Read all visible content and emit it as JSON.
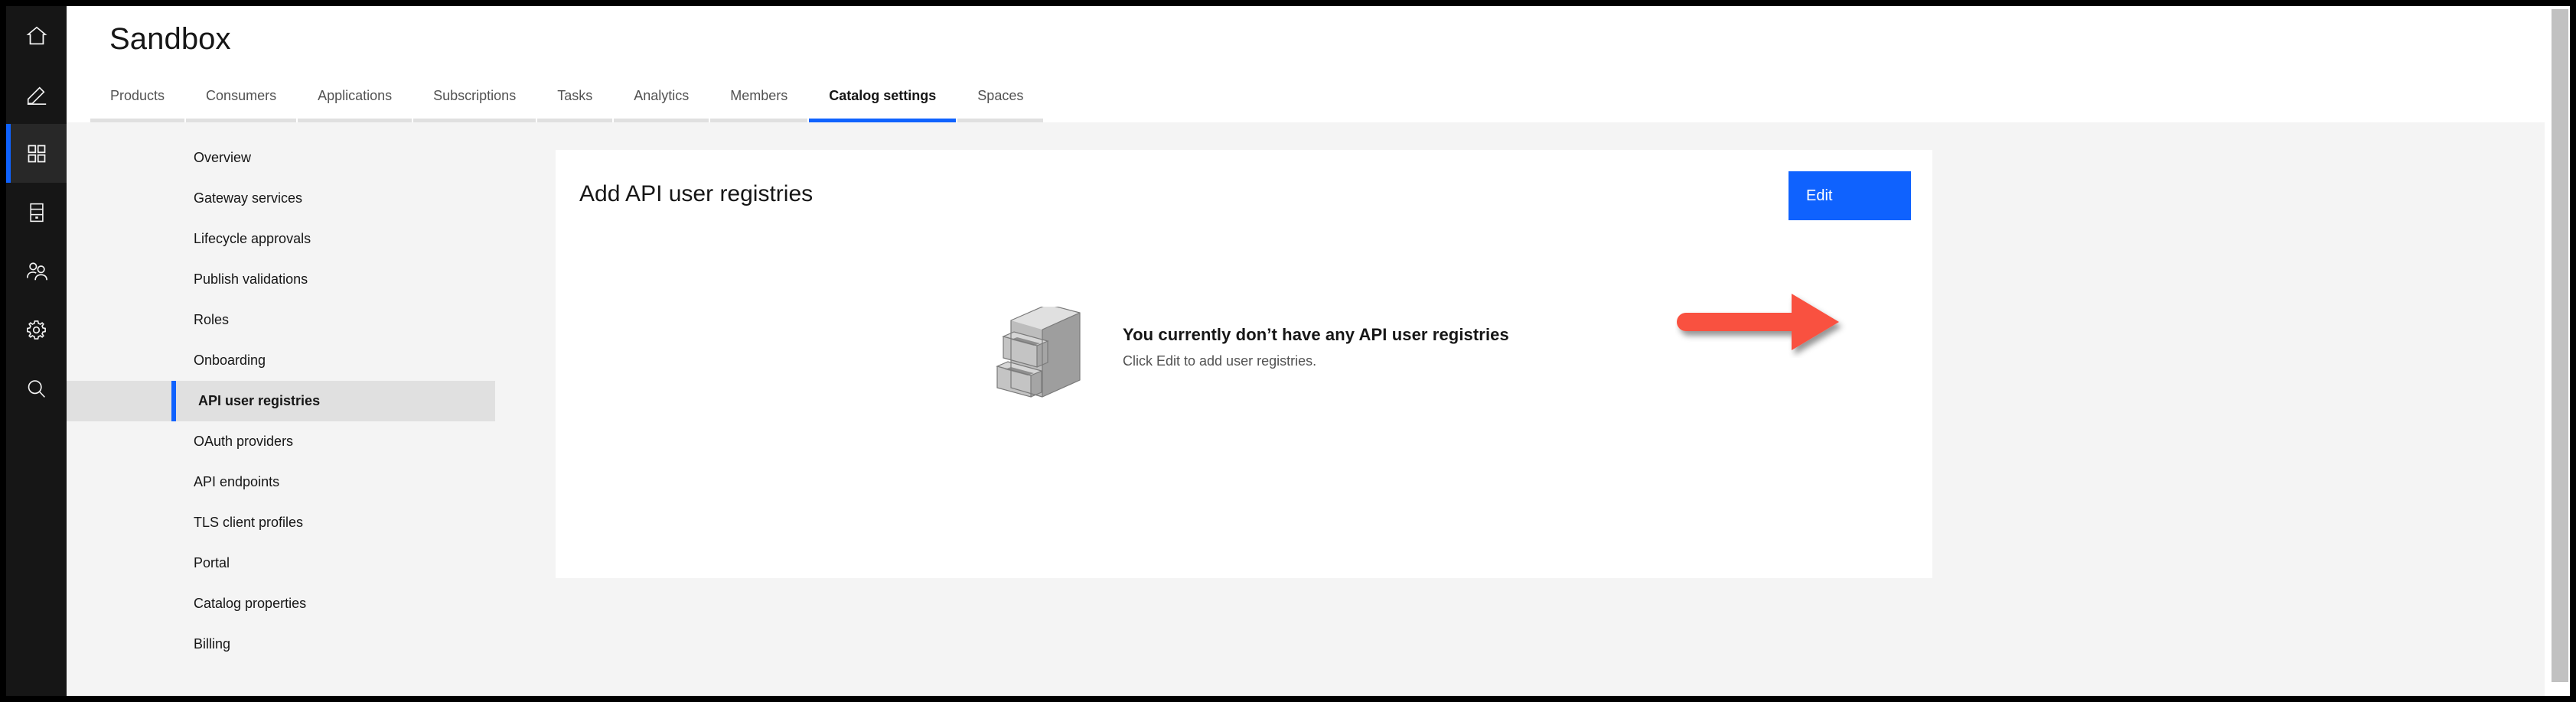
{
  "window": {
    "background": "#f4f4f4",
    "accent": "#0f62fe",
    "rail_background": "#161616",
    "annotation_color": "#f9513f"
  },
  "rail": {
    "items": [
      {
        "icon": "home-icon",
        "name": "home"
      },
      {
        "icon": "pencil-icon",
        "name": "edit"
      },
      {
        "icon": "grid-apps-icon",
        "name": "apps",
        "active": true
      },
      {
        "icon": "server-icon",
        "name": "server"
      },
      {
        "icon": "users-icon",
        "name": "users"
      },
      {
        "icon": "gear-icon",
        "name": "settings"
      },
      {
        "icon": "search-icon",
        "name": "search"
      }
    ]
  },
  "header": {
    "title": "Sandbox"
  },
  "tabs": {
    "items": [
      {
        "label": "Products",
        "active": false
      },
      {
        "label": "Consumers",
        "active": false
      },
      {
        "label": "Applications",
        "active": false
      },
      {
        "label": "Subscriptions",
        "active": false
      },
      {
        "label": "Tasks",
        "active": false
      },
      {
        "label": "Analytics",
        "active": false
      },
      {
        "label": "Members",
        "active": false
      },
      {
        "label": "Catalog settings",
        "active": true
      },
      {
        "label": "Spaces",
        "active": false
      }
    ],
    "active_label": "Catalog settings"
  },
  "subnav": {
    "items": [
      {
        "label": "Overview",
        "selected": false
      },
      {
        "label": "Gateway services",
        "selected": false
      },
      {
        "label": "Lifecycle approvals",
        "selected": false
      },
      {
        "label": "Publish validations",
        "selected": false
      },
      {
        "label": "Roles",
        "selected": false
      },
      {
        "label": "Onboarding",
        "selected": false
      },
      {
        "label": "API user registries",
        "selected": true
      },
      {
        "label": "OAuth providers",
        "selected": false
      },
      {
        "label": "API endpoints",
        "selected": false
      },
      {
        "label": "TLS client profiles",
        "selected": false
      },
      {
        "label": "Portal",
        "selected": false
      },
      {
        "label": "Catalog properties",
        "selected": false
      },
      {
        "label": "Billing",
        "selected": false
      }
    ],
    "selected_label": "API user registries"
  },
  "card": {
    "title": "Add API user registries",
    "edit_label": "Edit",
    "empty_state": {
      "illustration": "filing-cabinet-illustration",
      "heading": "You currently don’t have any API user registries",
      "subtext": "Click Edit to add user registries."
    }
  },
  "annotation": {
    "type": "arrow",
    "direction": "right",
    "target": "Edit",
    "color": "#f9513f"
  },
  "scrollbar": {
    "orientation": "vertical",
    "thumb_color": "#c1c1c1"
  }
}
